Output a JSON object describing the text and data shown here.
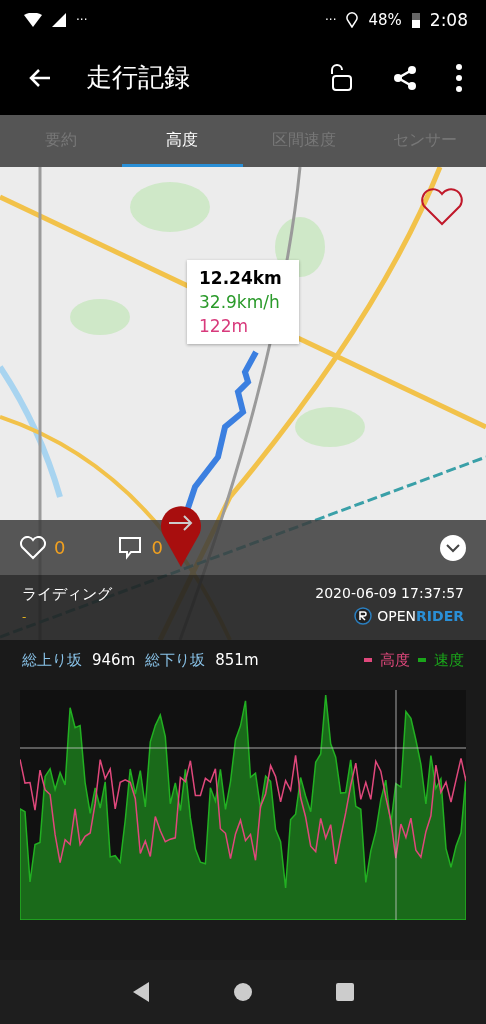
{
  "status_bar": {
    "more_left": "···",
    "more_right": "···",
    "battery": "48%",
    "time": "2:08"
  },
  "app_bar": {
    "title": "走行記録"
  },
  "tabs": [
    {
      "label": "要約",
      "selected": false
    },
    {
      "label": "高度",
      "selected": true
    },
    {
      "label": "区間速度",
      "selected": false
    },
    {
      "label": "センサー",
      "selected": false
    }
  ],
  "map": {
    "kind": "picture",
    "favorite": false,
    "tooltip": {
      "distance": "12.24km",
      "speed": "32.9km/h",
      "altitude": "122m"
    }
  },
  "actions": {
    "likes": "0",
    "comments": "0",
    "expanded": false
  },
  "activity": {
    "type": "ライディング",
    "note": "-",
    "datetime": "2020-06-09 17:37:57",
    "brand_prefix": "OPEN",
    "brand_suffix": "RIDER"
  },
  "stats": {
    "climb_label": "総上り坂",
    "climb": "946m",
    "descent_label": "総下り坂",
    "descent": "851m",
    "legend": [
      {
        "label": "高度",
        "color": "#e0487c"
      },
      {
        "label": "速度",
        "color": "#1aa51a"
      }
    ]
  }
}
